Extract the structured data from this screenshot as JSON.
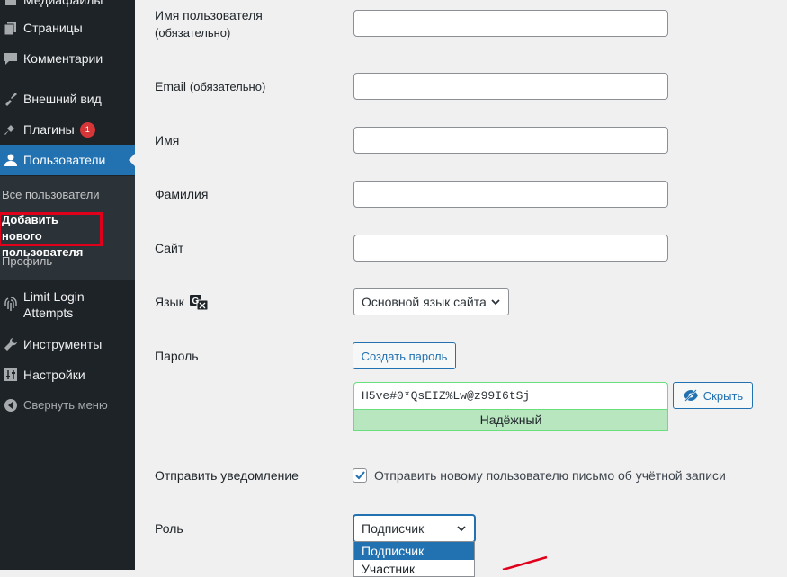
{
  "sidebar": {
    "items": [
      {
        "label": "Медиафайлы",
        "icon": "media-icon"
      },
      {
        "label": "Страницы",
        "icon": "pages-icon"
      },
      {
        "label": "Комментарии",
        "icon": "comments-icon"
      },
      {
        "label": "Внешний вид",
        "icon": "appearance-icon"
      },
      {
        "label": "Плагины",
        "icon": "plugins-icon",
        "badge": "1"
      },
      {
        "label": "Пользователи",
        "icon": "users-icon"
      },
      {
        "label": "Limit Login Attempts",
        "icon": "fingerprint-icon"
      },
      {
        "label": "Инструменты",
        "icon": "tools-icon"
      },
      {
        "label": "Настройки",
        "icon": "settings-icon"
      },
      {
        "label": "Свернуть меню",
        "icon": "collapse-icon"
      }
    ],
    "submenu": [
      "Все пользователи",
      "Добавить нового пользователя",
      "Профиль"
    ]
  },
  "form": {
    "username_label": "Имя пользователя",
    "username_req": "(обязательно)",
    "email_label": "Email",
    "email_req": "(обязательно)",
    "firstname_label": "Имя",
    "lastname_label": "Фамилия",
    "website_label": "Сайт",
    "language_label": "Язык",
    "language_value": "Основной язык сайта",
    "password_label": "Пароль",
    "generate_button": "Создать пароль",
    "password_value": "H5ve#0*QsEIZ%Lw@z99I6tSj",
    "hide_button": "Скрыть",
    "strength": "Надёжный",
    "notify_label": "Отправить уведомление",
    "notify_text": "Отправить новому пользователю письмо об учётной записи",
    "notify_checked": true,
    "role_label": "Роль",
    "role_value": "Подписчик",
    "role_options": [
      "Подписчик",
      "Участник"
    ]
  },
  "colors": {
    "accent": "#2271b1",
    "badge": "#d63638",
    "highlight": "#e0001b",
    "strength_bg": "#b8e6bf"
  }
}
